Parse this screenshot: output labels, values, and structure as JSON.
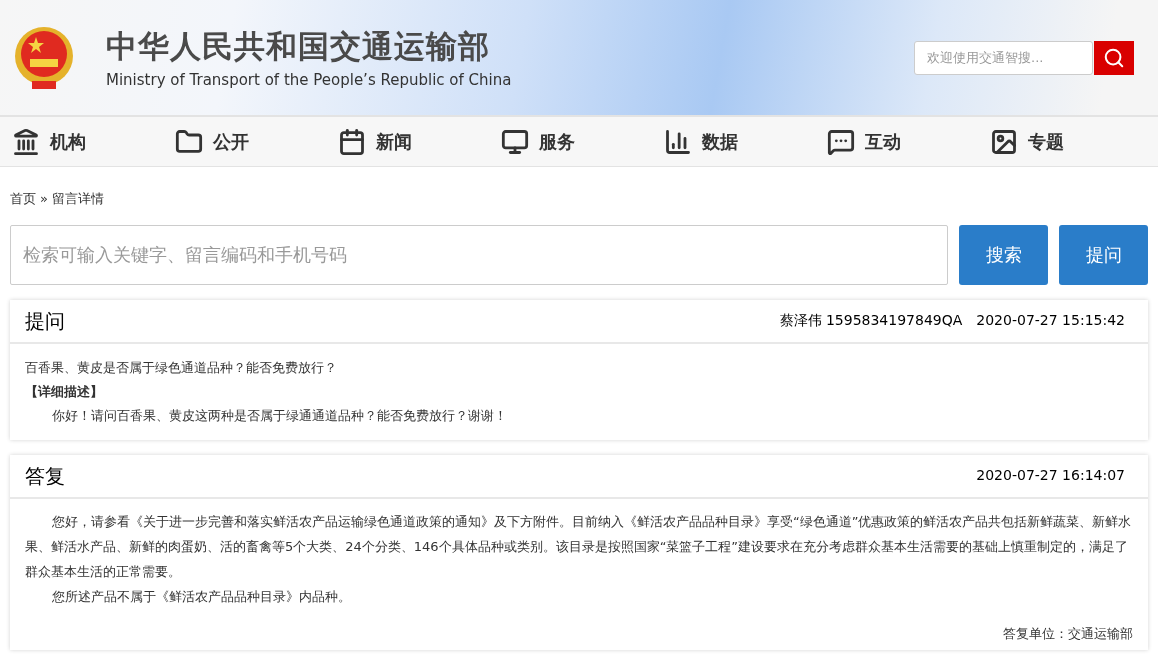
{
  "header": {
    "title": "中华人民共和国交通运输部",
    "subtitle": "Ministry of Transport of the People’s Republic of China",
    "search": {
      "placeholder": "欢迎使用交通智搜..."
    }
  },
  "nav": [
    {
      "kind": "org",
      "label": "机构"
    },
    {
      "kind": "open",
      "label": "公开"
    },
    {
      "kind": "news",
      "label": "新闻"
    },
    {
      "kind": "service",
      "label": "服务"
    },
    {
      "kind": "data",
      "label": "数据"
    },
    {
      "kind": "interact",
      "label": "互动"
    },
    {
      "kind": "topic",
      "label": "专题"
    }
  ],
  "breadcrumb": [
    "首页",
    "»",
    "留言详情"
  ],
  "search": {
    "placeholder": "检索可输入关键字、留言编码和手机号码",
    "buttons": [
      "搜索",
      "提问"
    ]
  },
  "question": {
    "title": "提问",
    "author": "蔡泽伟",
    "code": "1595834197849QA",
    "time": "2020-07-27 15:15:42",
    "subject": "百香果、黄皮是否属于绿色通道品种？能否免费放行？",
    "detail_label": "【详细描述】",
    "detail": "你好！请问百香果、黄皮这两种是否属于绿通通道品种？能否免费放行？谢谢！"
  },
  "answer": {
    "title": "答复",
    "time": "2020-07-27 16:14:07",
    "paragraphs": [
      "您好，请参看《关于进一步完善和落实鲜活农产品运输绿色通道政策的通知》及下方附件。目前纳入《鲜活农产品品种目录》享受“绿色通道”优惠政策的鲜活农产品共包括新鲜蔬菜、新鲜水果、鲜活水产品、新鲜的肉蛋奶、活的畜禽等5个大类、24个分类、146个具体品种或类别。该目录是按照国家“菜篮子工程”建设要求在充分考虑群众基本生活需要的基础上慎重制定的，满足了群众基本生活的正常需要。",
      "您所述产品不属于《鲜活农产品品种目录》内品种。"
    ],
    "unit": "答复单位：交通运输部"
  }
}
